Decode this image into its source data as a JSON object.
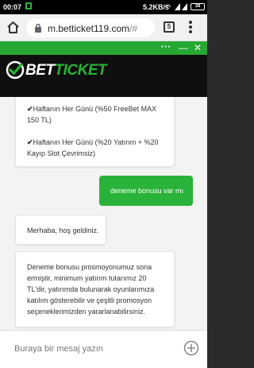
{
  "status_bar": {
    "time": "00:07",
    "network_speed": "5.2KB/s",
    "battery": "38"
  },
  "browser": {
    "url_host": "m.betticket119.com",
    "url_path": "/#",
    "tab_count": "5"
  },
  "brand": {
    "logo_part1": "BET",
    "logo_part2": "TICKET",
    "accent": "#27b434",
    "controls": {
      "more": "• • •",
      "minimize": "—",
      "close": "✕"
    }
  },
  "chat": {
    "messages": [
      {
        "from": "bot",
        "items": [
          {
            "check": "✔",
            "text": "Haftanın Her Günü (%50 FreeBet MAX 150 TL)"
          },
          {
            "check": "✔",
            "text": "Haftanın Her Günü (%20 Yatırım + %20 Kayıp Slot Çevrimsiz)"
          }
        ]
      },
      {
        "from": "user",
        "text": "deneme bonusu var mı"
      },
      {
        "from": "bot",
        "text": "Merhaba, hoş geldiniz."
      },
      {
        "from": "bot",
        "text": "Deneme bonusu prosmoyonumuz sona ermiştir, minimum yatırım tutarımız 20 TL'dir, yatırımda bulunarak oyunlarımıza katılım gösterebilir ve çeşitli promosyon seçeneklerimizden yararlanabilirsiniz."
      }
    ]
  },
  "composer": {
    "placeholder": "Buraya bir mesaj yazın"
  }
}
